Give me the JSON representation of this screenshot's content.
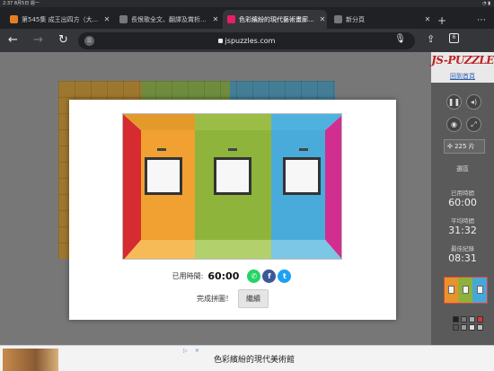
{
  "status_bar": {
    "time": "2:37",
    "date": "8月5日 週一",
    "battery": "◔ ▮"
  },
  "tabs": [
    {
      "title": "第545集 成王出四方（大...",
      "favicon_color": "#e67e22"
    },
    {
      "title": "長恨歌全文、翻譯及賞析...",
      "favicon_color": "#777777"
    },
    {
      "title": "色彩繽紛的現代藝術畫廊...",
      "favicon_color": "#e91e63"
    },
    {
      "title": "新分頁",
      "favicon_color": "#777777"
    }
  ],
  "toolbar": {
    "back": "←",
    "forward": "→",
    "reload": "↻",
    "url": "jspuzzles.com",
    "tab_count": "6",
    "new_tab": "+",
    "menu": "⋯"
  },
  "modal": {
    "elapsed_label": "已用時間:",
    "elapsed_value": "60:00",
    "complete_message": "完成拼圖！",
    "continue_button": "繼續",
    "share": {
      "whatsapp": "✆",
      "facebook": "f",
      "twitter": "t"
    }
  },
  "panel": {
    "logo": "JS-PUZZLE",
    "home_link": "回到首頁",
    "size_value": "225 片",
    "shuffle_label": "選區",
    "elapsed_label": "已用時間",
    "elapsed_value": "60:00",
    "avg_label": "平均時間",
    "avg_value": "31:32",
    "best_label": "最佳紀錄",
    "best_value": "08:31"
  },
  "ad": {
    "text": "色彩繽紛的現代美術館",
    "choices": "▷",
    "close": "✕"
  },
  "colors": {
    "accent": "#b22222",
    "link": "#2a5db0"
  }
}
